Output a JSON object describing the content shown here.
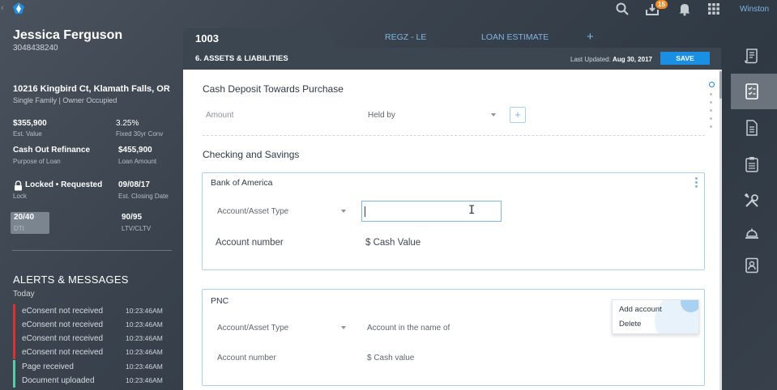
{
  "topbar": {
    "user_name": "Winston",
    "notification_count": "15",
    "icons": [
      "search-icon",
      "inbox-download-icon",
      "bell-icon",
      "apps-grid-icon"
    ]
  },
  "borrower": {
    "name": "Jessica Ferguson",
    "phone": "3048438240",
    "address": "10216 Kingbird Ct, Klamath Falls, OR",
    "property_type": "Single Family | Owner Occupied"
  },
  "stats": {
    "est_value": "$355,900",
    "est_value_label": "Est. Value",
    "rate": "3.25%",
    "rate_label": "Fixed 30yr Conv",
    "purpose": "Cash Out Refinance",
    "purpose_label": "Purpose of Loan",
    "loan_amount": "$455,900",
    "loan_amount_label": "Loan Amount",
    "lock_status": "Locked • Requested",
    "lock_label": "Lock",
    "closing_date": "09/08/17",
    "closing_label": "Est. Closing Date",
    "dti": "20/40",
    "dti_label": "DTI",
    "ltv": "90/95",
    "ltv_label": "LTV/CLTV"
  },
  "alerts": {
    "title": "ALERTS & MESSAGES",
    "group": "Today",
    "items": [
      {
        "text": "eConsent not received",
        "time": "10:23:46AM",
        "color": "#d9342b"
      },
      {
        "text": "eConsent not received",
        "time": "10:23:46AM",
        "color": "#d9342b"
      },
      {
        "text": "eConsent not received",
        "time": "10:23:46AM",
        "color": "#d9342b"
      },
      {
        "text": "eConsent not received",
        "time": "10:23:46AM",
        "color": "#d9342b"
      },
      {
        "text": "Page received",
        "time": "10:23:46AM",
        "color": "#4fd1a5"
      },
      {
        "text": "Document uploaded",
        "time": "10:23:46AM",
        "color": "#4fd1a5"
      }
    ]
  },
  "tabs": {
    "active": "1003",
    "links": [
      "REGZ - LE",
      "LOAN ESTIMATE"
    ]
  },
  "section": {
    "title": "6. ASSETS & LIABILITIES",
    "last_updated_label": "Last Updated:",
    "last_updated_date": "Aug 30, 2017",
    "save_label": "SAVE"
  },
  "cash_deposit": {
    "title": "Cash Deposit Towards Purchase",
    "amount_label": "Amount",
    "held_by_label": "Held by"
  },
  "checking": {
    "title": "Checking and Savings",
    "accounts": [
      {
        "bank": "Bank of America",
        "type_label": "Account/Asset Type",
        "number_label": "Account number",
        "cash_label": "$ Cash Value",
        "input_value": ""
      },
      {
        "bank": "PNC",
        "type_label": "Account/Asset Type",
        "name_label": "Account in the name of",
        "number_label": "Account number",
        "cash_label": "$ Cash value"
      }
    ]
  },
  "context_menu": {
    "items": [
      "Add account",
      "Delete"
    ]
  },
  "colors": {
    "accent": "#1a8fe3",
    "link": "#7fb4e3",
    "alert_red": "#d9342b",
    "alert_green": "#4fd1a5"
  }
}
